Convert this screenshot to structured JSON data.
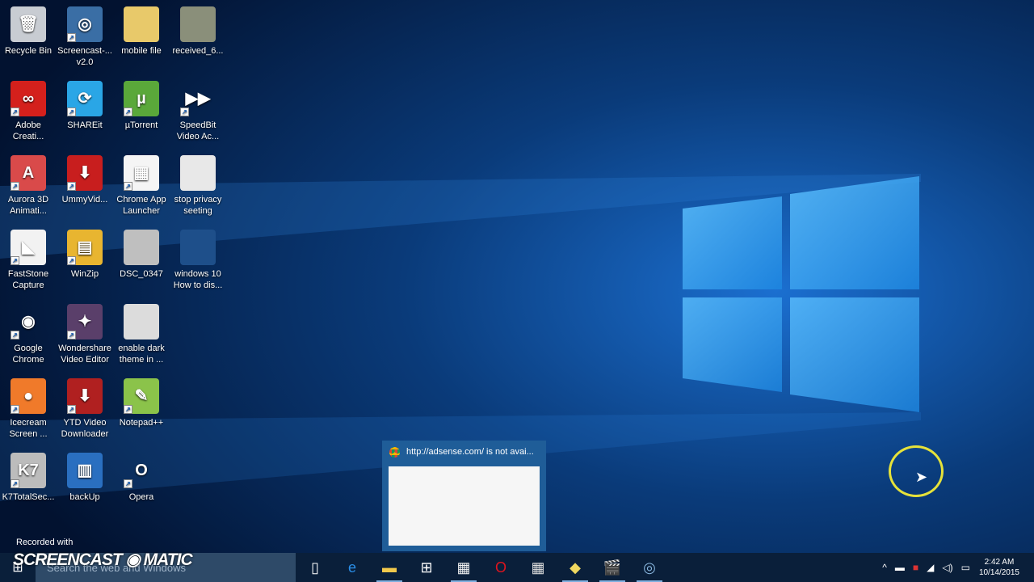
{
  "desktop_icons": [
    {
      "label": "Recycle Bin",
      "color": "#c8ccd2",
      "glyph": "🗑",
      "shortcut": false
    },
    {
      "label": "Screencast-... v2.0",
      "color": "#3a6ea5",
      "glyph": "◎",
      "shortcut": true
    },
    {
      "label": "mobile file",
      "color": "#e8c96a",
      "glyph": "",
      "shortcut": false
    },
    {
      "label": "received_6...",
      "color": "#8a8f7a",
      "glyph": "",
      "shortcut": false
    },
    {
      "label": "Adobe Creati...",
      "color": "#d4201c",
      "glyph": "∞",
      "shortcut": true
    },
    {
      "label": "SHAREit",
      "color": "#2aa6e6",
      "glyph": "⟳",
      "shortcut": true
    },
    {
      "label": "µTorrent",
      "color": "#5aa83a",
      "glyph": "µ",
      "shortcut": true
    },
    {
      "label": "SpeedBit Video Ac...",
      "color": "transparent",
      "glyph": "▶▶",
      "shortcut": true
    },
    {
      "label": "Aurora 3D Animati...",
      "color": "#d94a4a",
      "glyph": "A",
      "shortcut": true
    },
    {
      "label": "UmmyVid...",
      "color": "#c81e1e",
      "glyph": "⬇",
      "shortcut": true
    },
    {
      "label": "Chrome App Launcher",
      "color": "#f5f5f5",
      "glyph": "▦",
      "shortcut": true
    },
    {
      "label": "stop privacy seeting",
      "color": "#e8e8e8",
      "glyph": "",
      "shortcut": false
    },
    {
      "label": "FastStone Capture",
      "color": "#f2f2f2",
      "glyph": "◣",
      "shortcut": true
    },
    {
      "label": "WinZip",
      "color": "#e8b530",
      "glyph": "▤",
      "shortcut": true
    },
    {
      "label": "DSC_0347",
      "color": "#bfbfbf",
      "glyph": "",
      "shortcut": false
    },
    {
      "label": "windows 10 How to dis...",
      "color": "#1e4f8a",
      "glyph": "",
      "shortcut": false
    },
    {
      "label": "Google Chrome",
      "color": "transparent",
      "glyph": "◉",
      "shortcut": true
    },
    {
      "label": "Wondershare Video Editor",
      "color": "#5a3f6a",
      "glyph": "✦",
      "shortcut": true
    },
    {
      "label": "enable dark theme in ...",
      "color": "#dcdcdc",
      "glyph": "",
      "shortcut": false
    },
    {
      "label": "Icecream Screen ...",
      "color": "#f07a2a",
      "glyph": "●",
      "shortcut": true
    },
    {
      "label": "YTD Video Downloader",
      "color": "#b02020",
      "glyph": "⬇",
      "shortcut": true
    },
    {
      "label": "Notepad++",
      "color": "#8bc34a",
      "glyph": "✎",
      "shortcut": true
    },
    {
      "label": "K7TotalSec...",
      "color": "#bcbcbc",
      "glyph": "K7",
      "shortcut": true
    },
    {
      "label": "backUp",
      "color": "#2a6fc0",
      "glyph": "▥",
      "shortcut": false
    },
    {
      "label": "Opera",
      "color": "transparent",
      "glyph": "O",
      "shortcut": true
    }
  ],
  "preview": {
    "title": "http://adsense.com/ is not avai..."
  },
  "watermark": {
    "line1": "Recorded with",
    "brand": "SCREENCAST ◉ MATIC"
  },
  "taskbar": {
    "search_placeholder": "Search the web and Windows",
    "apps": [
      {
        "name": "task-view",
        "glyph": "▯",
        "color": "#fff",
        "running": false
      },
      {
        "name": "edge",
        "glyph": "e",
        "color": "#2a8fe8",
        "running": false
      },
      {
        "name": "file-explorer",
        "glyph": "▬",
        "color": "#f2c94c",
        "running": true
      },
      {
        "name": "store",
        "glyph": "⊞",
        "color": "#fff",
        "running": false
      },
      {
        "name": "chrome-app-launcher",
        "glyph": "▦",
        "color": "#f2f2f2",
        "running": true
      },
      {
        "name": "opera",
        "glyph": "O",
        "color": "#e0141e",
        "running": false
      },
      {
        "name": "calculator",
        "glyph": "▦",
        "color": "#ddd",
        "running": false
      },
      {
        "name": "photos",
        "glyph": "◆",
        "color": "#f0d860",
        "running": true
      },
      {
        "name": "movies",
        "glyph": "🎬",
        "color": "#fff",
        "running": true
      },
      {
        "name": "screencast",
        "glyph": "◎",
        "color": "#8ab8e0",
        "running": true
      }
    ],
    "time": "2:42 AM",
    "date": "10/14/2015"
  }
}
